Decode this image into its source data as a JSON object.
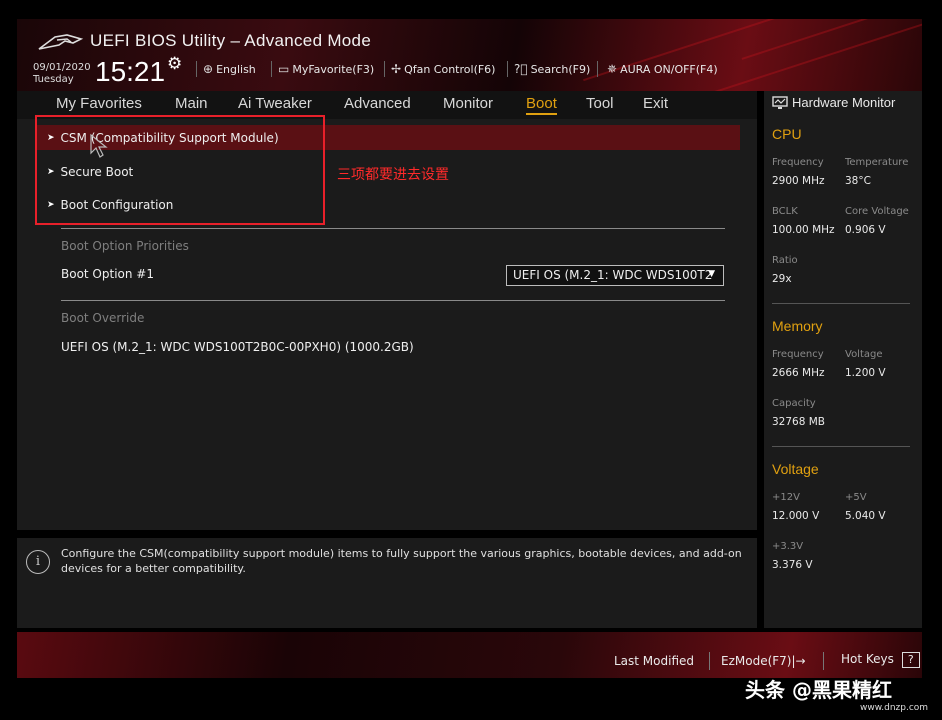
{
  "header": {
    "title": "UEFI BIOS Utility – Advanced Mode",
    "date": "09/01/2020",
    "day": "Tuesday",
    "time": "15:21",
    "buttons": [
      {
        "label": "English",
        "icon": "globe-icon"
      },
      {
        "label": "MyFavorite(F3)",
        "icon": "favorite-icon"
      },
      {
        "label": "Qfan Control(F6)",
        "icon": "fan-icon"
      },
      {
        "label": "Search(F9)",
        "icon": "search-help-icon"
      },
      {
        "label": "AURA ON/OFF(F4)",
        "icon": "aura-icon"
      }
    ]
  },
  "tabs": [
    {
      "label": "My Favorites"
    },
    {
      "label": "Main"
    },
    {
      "label": "Ai Tweaker"
    },
    {
      "label": "Advanced"
    },
    {
      "label": "Monitor"
    },
    {
      "label": "Boot",
      "active": true
    },
    {
      "label": "Tool"
    },
    {
      "label": "Exit"
    }
  ],
  "main": {
    "submenus": [
      {
        "label": "CSM (Compatibility Support Module)"
      },
      {
        "label": "Secure Boot"
      },
      {
        "label": "Boot Configuration"
      }
    ],
    "annotation": "三项都要进去设置",
    "boot_priorities_section": "Boot Option Priorities",
    "boot_option_1_label": "Boot Option #1",
    "boot_option_1_value": "UEFI OS (M.2_1: WDC WDS100T2",
    "boot_override_section": "Boot Override",
    "boot_override_item": "UEFI OS (M.2_1: WDC WDS100T2B0C-00PXH0) (1000.2GB)"
  },
  "help": {
    "text": "Configure the CSM(compatibility support module) items to fully support the various graphics, bootable devices, and add-on devices for a better compatibility."
  },
  "hw_monitor": {
    "title": "Hardware Monitor",
    "cpu": {
      "heading": "CPU",
      "frequency_label": "Frequency",
      "frequency": "2900 MHz",
      "temperature_label": "Temperature",
      "temperature": "38°C",
      "bclk_label": "BCLK",
      "bclk": "100.00 MHz",
      "core_voltage_label": "Core Voltage",
      "core_voltage": "0.906 V",
      "ratio_label": "Ratio",
      "ratio": "29x"
    },
    "memory": {
      "heading": "Memory",
      "frequency_label": "Frequency",
      "frequency": "2666 MHz",
      "voltage_label": "Voltage",
      "voltage": "1.200 V",
      "capacity_label": "Capacity",
      "capacity": "32768 MB"
    },
    "voltage": {
      "heading": "Voltage",
      "v12_label": "+12V",
      "v12": "12.000 V",
      "v5_label": "+5V",
      "v5": "5.040 V",
      "v33_label": "+3.3V",
      "v33": "3.376 V"
    }
  },
  "footer": {
    "last_modified": "Last Modified",
    "ezmode": "EzMode(F7)|→",
    "hot_keys": "Hot Keys",
    "hot_keys_icon": "?"
  },
  "watermark": {
    "text": "头条 @黑果精红",
    "url": "www.dnzp.com"
  },
  "colors": {
    "accent": "#e0a010",
    "highlight": "#5a1014",
    "annotation_red": "#e8202a"
  }
}
